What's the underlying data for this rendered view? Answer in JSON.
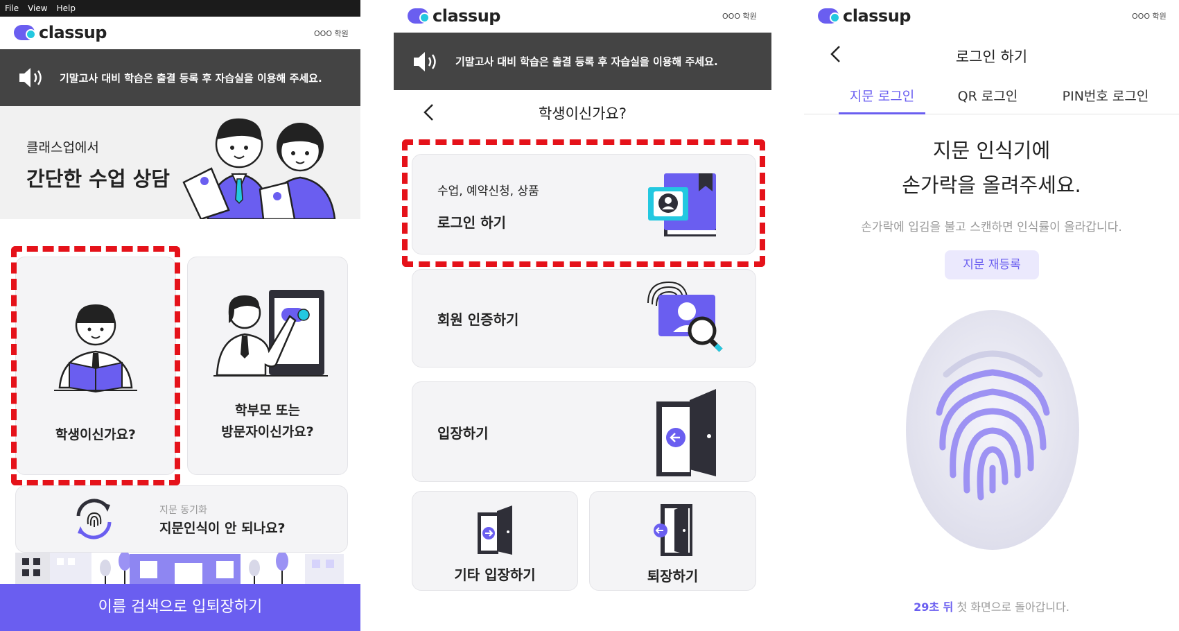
{
  "menubar": {
    "items": [
      "File",
      "View",
      "Help"
    ]
  },
  "brand": {
    "name": "classup",
    "academy": "OOO 학원"
  },
  "notice": {
    "text": "기말고사 대비 학습은 출결 등록 후 자습실을 이용해 주세요."
  },
  "screen1": {
    "banner": {
      "subtitle": "클래스업에서",
      "title": "간단한 수업 상담"
    },
    "student_card": {
      "label": "학생이신가요?"
    },
    "parent_card": {
      "line1": "학부모 또는",
      "line2": "방문자이신가요?"
    },
    "sync_card": {
      "small": "지문 동기화",
      "title": "지문인식이 안 되나요?"
    },
    "bottom_button": "이름 검색으로 입퇴장하기"
  },
  "screen2": {
    "header_title": "학생이신가요?",
    "login_card": {
      "small": "수업, 예약신청, 상품",
      "title": "로그인 하기"
    },
    "verify_card": {
      "title": "회원 인증하기"
    },
    "enter_card": {
      "title": "입장하기"
    },
    "other_enter_card": {
      "title": "기타 입장하기"
    },
    "exit_card": {
      "title": "퇴장하기"
    }
  },
  "screen3": {
    "header_title": "로그인 하기",
    "tabs": [
      "지문 로그인",
      "QR 로그인",
      "PIN번호 로그인"
    ],
    "active_tab": 0,
    "heading_line1": "지문 인식기에",
    "heading_line2": "손가락을 올려주세요.",
    "hint": "손가락에 입김을 불고 스캔하면 인식률이 올라갑니다.",
    "reregister_button": "지문 재등록",
    "countdown_number": "29초 뒤",
    "countdown_rest": " 첫 화면으로 돌아갑니다."
  },
  "colors": {
    "accent": "#6a5ef0",
    "cyan": "#23c8e0",
    "notice_bg": "#444444",
    "highlight": "#e5121a"
  }
}
